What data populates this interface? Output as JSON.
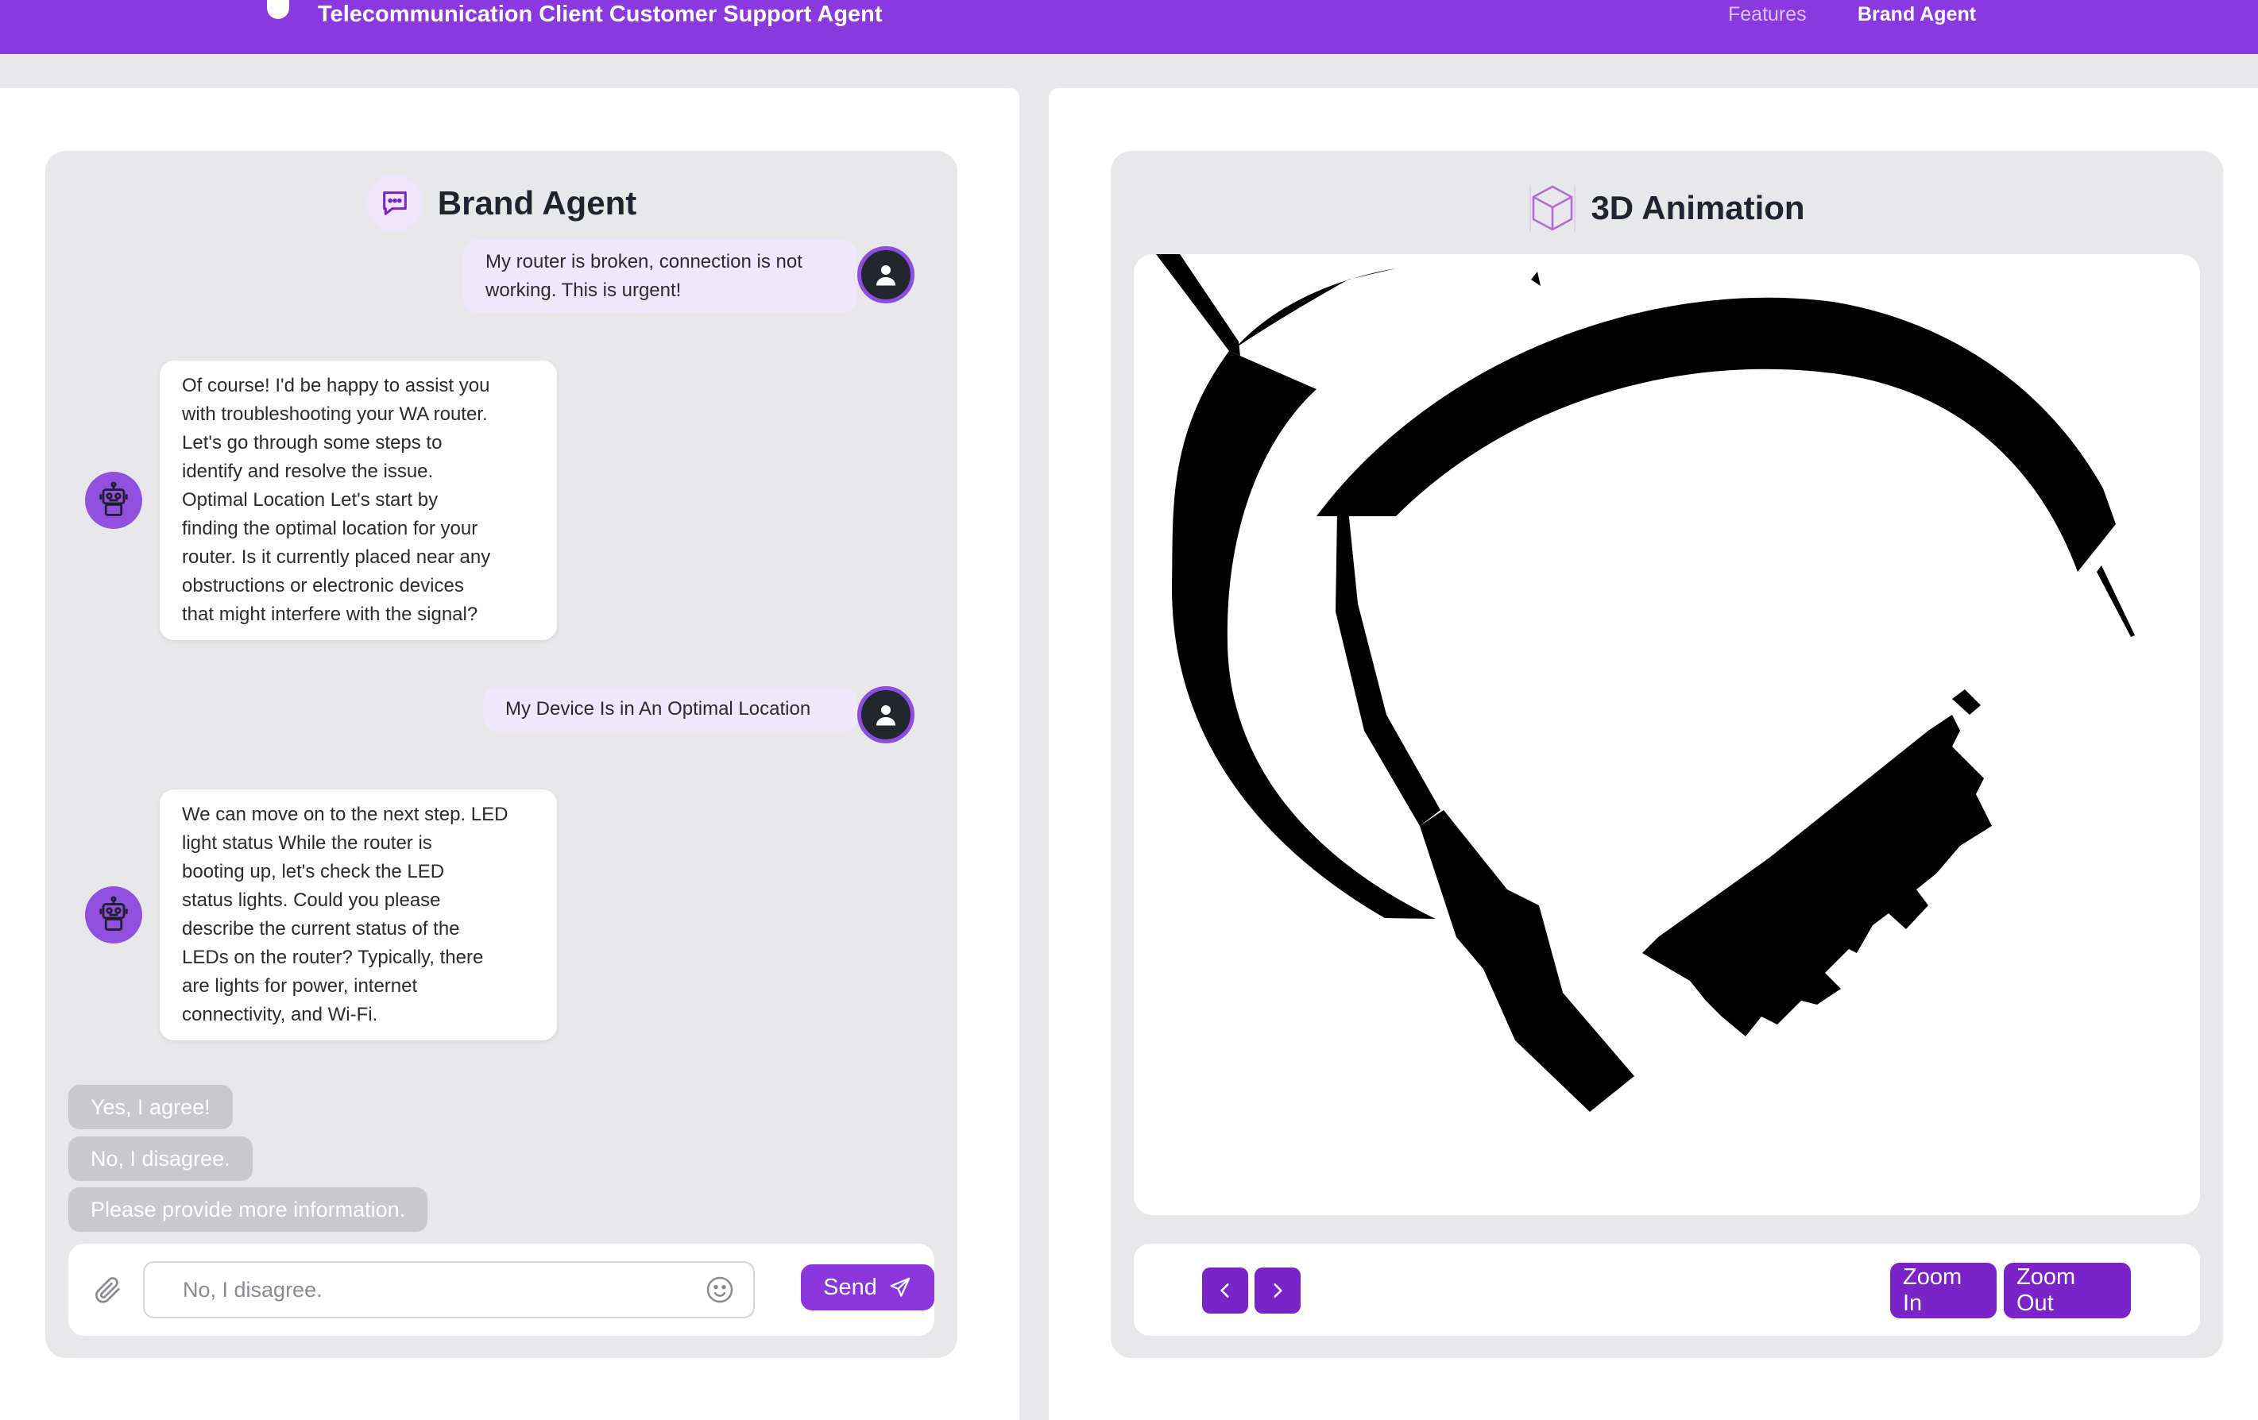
{
  "header": {
    "title": "Telecommunication Client Customer Support Agent",
    "nav": [
      {
        "label": "Features",
        "active": false
      },
      {
        "label": "Brand Agent",
        "active": true
      }
    ],
    "accent_color": "#8a38e0"
  },
  "chat": {
    "title": "Brand Agent",
    "icon": "chat-bubble-icon",
    "messages": [
      {
        "role": "user",
        "text": "My router is broken, connection is not working. This is urgent!",
        "lines": [
          "My router is broken, connection is not",
          "working. This is urgent!"
        ]
      },
      {
        "role": "bot",
        "lines": [
          "Of course! I'd be happy to assist you",
          "with troubleshooting your WA router.",
          "Let's go through some steps to",
          "identify and resolve the issue.",
          "Optimal Location Let's start by",
          "finding the optimal location for your",
          "router. Is it currently placed near any",
          "obstructions or electronic devices",
          "that might interfere with the signal?"
        ]
      },
      {
        "role": "user",
        "lines": [
          "My Device Is in An Optimal Location"
        ]
      },
      {
        "role": "bot",
        "lines": [
          "We can move on to the next step. LED",
          "light status While the router is",
          "booting up, let's check the LED",
          "status lights. Could you please",
          "describe the current status of the",
          "LEDs on the router? Typically, there",
          "are lights for power, internet",
          "connectivity, and Wi-Fi."
        ]
      }
    ],
    "quick_replies": [
      "Yes, I agree!",
      "No, I disagree.",
      "Please provide more information."
    ],
    "input": {
      "placeholder": "No, I disagree.",
      "value": ""
    },
    "send_label": "Send"
  },
  "animation": {
    "title": "3D Animation",
    "icon": "cube-icon",
    "zoom_in_label": "Zoom In",
    "zoom_out_label": "Zoom Out"
  }
}
